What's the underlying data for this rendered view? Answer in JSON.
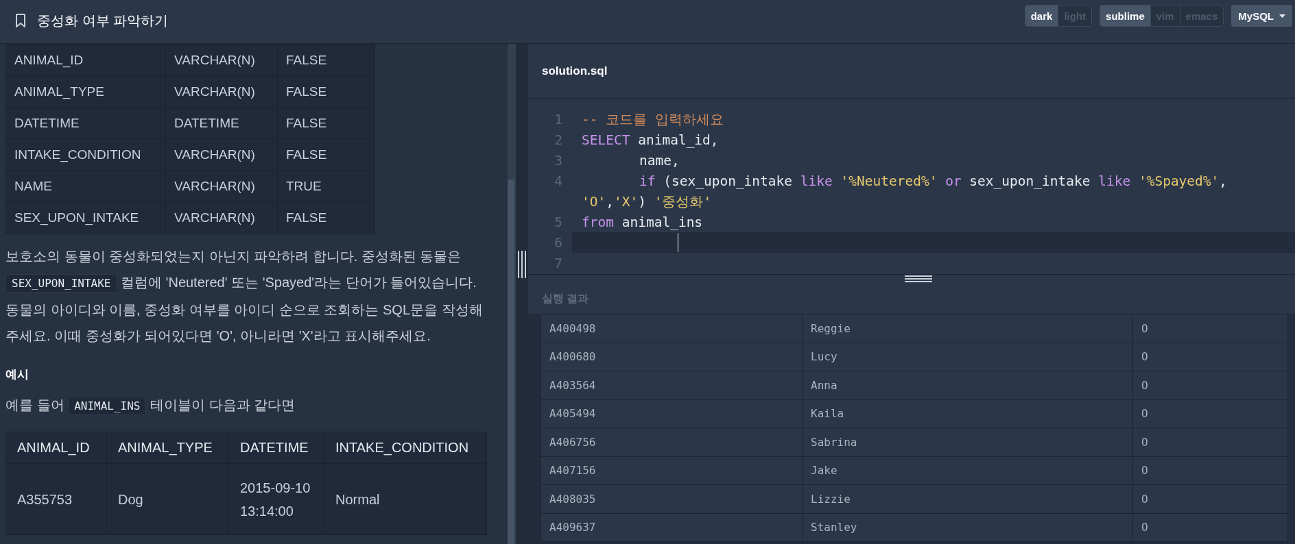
{
  "header": {
    "title": "중성화 여부 파악하기",
    "theme_toggle": [
      {
        "label": "dark",
        "selected": true
      },
      {
        "label": "light",
        "selected": false
      }
    ],
    "keymap_toggle": [
      {
        "label": "sublime",
        "selected": true
      },
      {
        "label": "vim",
        "selected": false
      },
      {
        "label": "emacs",
        "selected": false
      }
    ],
    "language_select": {
      "value": "MySQL"
    }
  },
  "problem": {
    "schema_table": {
      "rows": [
        [
          "ANIMAL_ID",
          "VARCHAR(N)",
          "FALSE"
        ],
        [
          "ANIMAL_TYPE",
          "VARCHAR(N)",
          "FALSE"
        ],
        [
          "DATETIME",
          "DATETIME",
          "FALSE"
        ],
        [
          "INTAKE_CONDITION",
          "VARCHAR(N)",
          "FALSE"
        ],
        [
          "NAME",
          "VARCHAR(N)",
          "TRUE"
        ],
        [
          "SEX_UPON_INTAKE",
          "VARCHAR(N)",
          "FALSE"
        ]
      ]
    },
    "description": [
      {
        "kind": "text",
        "text": "보호소의 동물이 중성화되었는지 아닌지 파악하려 합니다. 중성화된 동물은 "
      },
      {
        "kind": "code",
        "text": "SEX_UPON_INTAKE"
      },
      {
        "kind": "text",
        "text": " 컬럼에 'Neutered' 또는 'Spayed'라는 단어가 들어있습니다. 동물의 아이디와 이름, 중성화 여부를 아이디 순으로 조회하는 SQL문을 작성해주세요. 이때 중성화가 되어있다면 'O', 아니라면 'X'라고 표시해주세요."
      }
    ],
    "example_heading": "예시",
    "example_intro": [
      {
        "kind": "text",
        "text": "예를 들어 "
      },
      {
        "kind": "code",
        "text": "ANIMAL_INS"
      },
      {
        "kind": "text",
        "text": " 테이블이 다음과 같다면"
      }
    ],
    "example_table": {
      "columns": [
        "ANIMAL_ID",
        "ANIMAL_TYPE",
        "DATETIME",
        "INTAKE_CONDITION"
      ],
      "rows": [
        [
          "A355753",
          "Dog",
          "2015-09-10 13:14:00",
          "Normal"
        ]
      ]
    }
  },
  "editor": {
    "file_name": "solution.sql",
    "lines": [
      {
        "number": "1",
        "current": false,
        "tokens": [
          {
            "kind": "comment",
            "text": "-- 코드를 입력하세요"
          }
        ]
      },
      {
        "number": "2",
        "current": false,
        "tokens": [
          {
            "kind": "keyword",
            "text": "SELECT"
          },
          {
            "kind": "plain",
            "text": " animal_id,"
          }
        ]
      },
      {
        "number": "3",
        "current": false,
        "indented": true,
        "tokens": [
          {
            "kind": "plain",
            "text": "name,"
          }
        ]
      },
      {
        "number": "4",
        "current": false,
        "indented": true,
        "tokens": [
          {
            "kind": "keyword",
            "text": "if"
          },
          {
            "kind": "plain",
            "text": " (sex_upon_intake "
          },
          {
            "kind": "keyword",
            "text": "like "
          },
          {
            "kind": "string",
            "text": "'%Neutered%' "
          },
          {
            "kind": "keyword",
            "text": "or"
          },
          {
            "kind": "plain",
            "text": " sex_upon_intake "
          },
          {
            "kind": "keyword",
            "text": "like "
          },
          {
            "kind": "string",
            "text": "'%Spayed%'"
          },
          {
            "kind": "plain",
            "text": ","
          }
        ]
      },
      {
        "current": false,
        "tokens": [
          {
            "kind": "string",
            "text": "'O'"
          },
          {
            "kind": "plain",
            "text": ","
          },
          {
            "kind": "string",
            "text": "'X'"
          },
          {
            "kind": "plain",
            "text": ") "
          },
          {
            "kind": "string",
            "text": "'중성화'"
          }
        ]
      },
      {
        "number": "5",
        "current": false,
        "tokens": [
          {
            "kind": "keyword",
            "text": "from"
          },
          {
            "kind": "plain",
            "text": " animal_ins"
          }
        ]
      },
      {
        "number": "6",
        "current": true
      },
      {
        "number": "7",
        "current": false
      }
    ]
  },
  "results": {
    "heading": "실행 결과",
    "rows": [
      [
        "A400498",
        "Reggie",
        "O"
      ],
      [
        "A400680",
        "Lucy",
        "O"
      ],
      [
        "A403564",
        "Anna",
        "O"
      ],
      [
        "A405494",
        "Kaila",
        "O"
      ],
      [
        "A406756",
        "Sabrina",
        "O"
      ],
      [
        "A407156",
        "Jake",
        "O"
      ],
      [
        "A408035",
        "Lizzie",
        "O"
      ],
      [
        "A409637",
        "Stanley",
        "O"
      ]
    ]
  }
}
